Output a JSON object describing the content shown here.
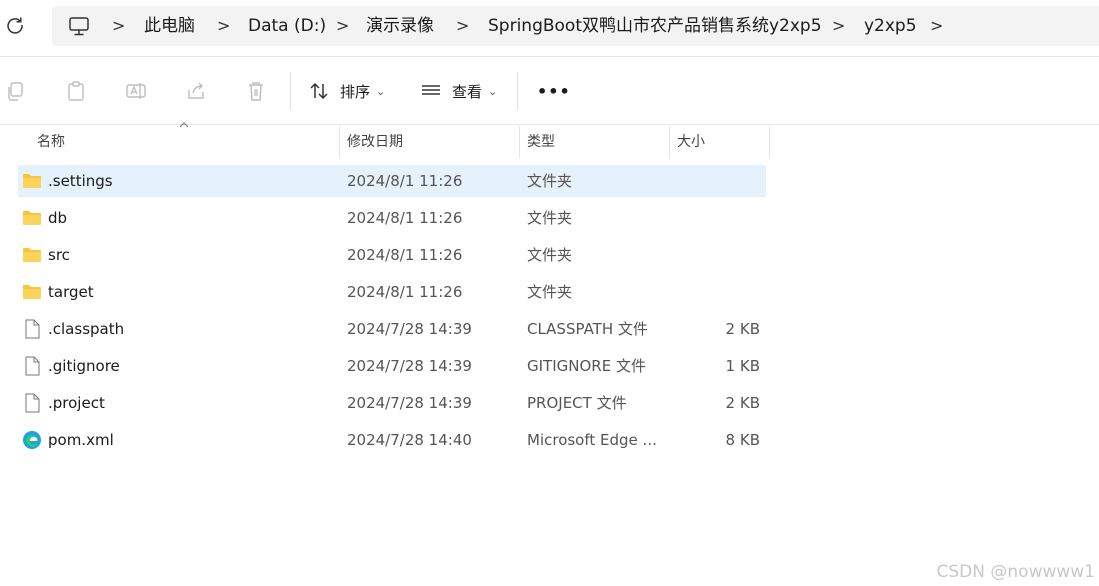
{
  "breadcrumb": {
    "items": [
      "此电脑",
      "Data (D:)",
      "演示录像",
      "SpringBoot双鸭山市农产品销售系统y2xp5",
      "y2xp5"
    ]
  },
  "toolbar": {
    "sort_label": "排序",
    "view_label": "查看",
    "more_label": "•••"
  },
  "columns": {
    "name": "名称",
    "date": "修改日期",
    "type": "类型",
    "size": "大小"
  },
  "files": [
    {
      "name": ".settings",
      "date": "2024/8/1 11:26",
      "type": "文件夹",
      "size": "",
      "icon": "folder-icon"
    },
    {
      "name": "db",
      "date": "2024/8/1 11:26",
      "type": "文件夹",
      "size": "",
      "icon": "folder-icon"
    },
    {
      "name": "src",
      "date": "2024/8/1 11:26",
      "type": "文件夹",
      "size": "",
      "icon": "folder-icon"
    },
    {
      "name": "target",
      "date": "2024/8/1 11:26",
      "type": "文件夹",
      "size": "",
      "icon": "folder-icon"
    },
    {
      "name": ".classpath",
      "date": "2024/7/28 14:39",
      "type": "CLASSPATH 文件",
      "size": "2 KB",
      "icon": "file-icon"
    },
    {
      "name": ".gitignore",
      "date": "2024/7/28 14:39",
      "type": "GITIGNORE 文件",
      "size": "1 KB",
      "icon": "file-icon"
    },
    {
      "name": ".project",
      "date": "2024/7/28 14:39",
      "type": "PROJECT 文件",
      "size": "2 KB",
      "icon": "file-icon"
    },
    {
      "name": "pom.xml",
      "date": "2024/7/28 14:40",
      "type": "Microsoft Edge ...",
      "size": "8 KB",
      "icon": "edge-icon"
    }
  ],
  "watermark": "CSDN @nowwww1",
  "colors": {
    "selected_row": "#e5f1fb",
    "folder": "#f8c43a",
    "address_bg": "#f3f3f3"
  }
}
